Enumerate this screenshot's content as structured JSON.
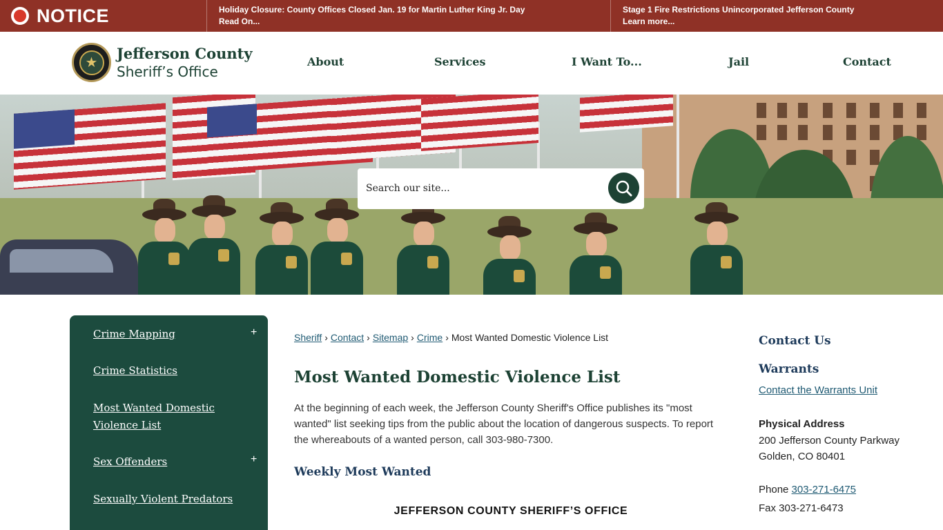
{
  "notice": {
    "label": "NOTICE",
    "alerts": [
      {
        "title": "Holiday Closure: County Offices Closed Jan. 19 for Martin Luther King Jr. Day",
        "more": "Read On..."
      },
      {
        "title": "Stage 1 Fire Restrictions Unincorporated Jefferson County",
        "more": "Learn more..."
      }
    ]
  },
  "header": {
    "logo_line1": "Jefferson County",
    "logo_line2": "Sheriff’s Office",
    "nav": [
      "About",
      "Services",
      "I Want To...",
      "Jail",
      "Contact"
    ]
  },
  "search": {
    "placeholder": "Search our site...",
    "icon": "search-icon"
  },
  "sidebar": {
    "items": [
      {
        "label": "Crime Mapping",
        "expandable": true
      },
      {
        "label": "Crime Statistics",
        "expandable": false
      },
      {
        "label": "Most Wanted Domestic Violence List",
        "expandable": false
      },
      {
        "label": "Sex Offenders",
        "expandable": true
      },
      {
        "label": "Sexually Violent Predators",
        "expandable": false
      }
    ],
    "expand_symbol": "+"
  },
  "breadcrumb": {
    "items": [
      "Sheriff",
      "Contact",
      "Sitemap",
      "Crime"
    ],
    "current": "Most Wanted Domestic Violence List",
    "separator": "›"
  },
  "main": {
    "title": "Most Wanted Domestic Violence List",
    "intro": "At the beginning of each week, the Jefferson County Sheriff's Office publishes its \"most wanted\" list seeking tips from the public about the location of dangerous suspects. To report the whereabouts of a wanted person, call 303-980-7300.",
    "subheading": "Weekly Most Wanted",
    "office_heading": "JEFFERSON COUNTY SHERIFF’S OFFICE"
  },
  "contact": {
    "heading": "Contact Us",
    "warrants_heading": "Warrants",
    "warrants_link": "Contact the Warrants Unit",
    "address_label": "Physical Address",
    "address_line1": "200 Jefferson County Parkway",
    "address_line2": "Golden, CO 80401",
    "phone_label": "Phone",
    "phone": "303-271-6475",
    "fax": "Fax 303-271-6473"
  },
  "colors": {
    "notice_bg": "#8f3126",
    "brand_green": "#1d4234",
    "sidebar_bg": "#1c4b3e",
    "link": "#1f5a73"
  }
}
